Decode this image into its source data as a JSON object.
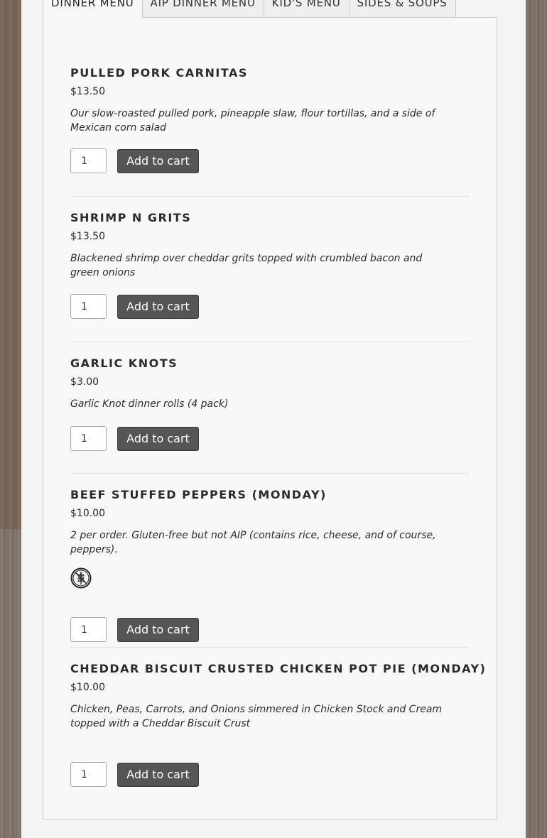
{
  "tabs": [
    {
      "label": "DINNER MENU",
      "active": true
    },
    {
      "label": "AIP DINNER MENU",
      "active": false
    },
    {
      "label": "KID'S MENU",
      "active": false
    },
    {
      "label": "SIDES & SOUPS",
      "active": false
    }
  ],
  "items": [
    {
      "title": "PULLED PORK CARNITAS",
      "price": "$13.50",
      "description": "Our slow-roasted pulled pork, pineapple slaw, flour tortillas, and a side of Mexican corn salad",
      "quantity": "1",
      "button": "Add to cart"
    },
    {
      "title": "SHRIMP N GRITS",
      "price": "$13.50",
      "description": "Blackened shrimp over cheddar grits topped with crumbled bacon and green onions",
      "quantity": "1",
      "button": "Add to cart"
    },
    {
      "title": "GARLIC KNOTS",
      "price": "$3.00",
      "description": "Garlic Knot dinner rolls (4 pack)",
      "quantity": "1",
      "button": "Add to cart"
    },
    {
      "title": "BEEF STUFFED PEPPERS (MONDAY)",
      "price": "$10.00",
      "description": "2 per order. Gluten-free but not AIP (contains rice, cheese, and of course, peppers).",
      "quantity": "1",
      "button": "Add to cart",
      "icon": "gluten-free-icon"
    },
    {
      "title": "CHEDDAR BISCUIT CRUSTED CHICKEN POT PIE (MONDAY)",
      "price": "$10.00",
      "description": "Chicken, Peas, Carrots, and Onions simmered in Chicken Stock and Cream topped with a Cheddar Biscuit Crust",
      "quantity": "1",
      "button": "Add to cart"
    }
  ],
  "colors": {
    "button_bg": "#555555",
    "panel_bg": "#f8f8f8",
    "border": "#c9c9c9"
  }
}
